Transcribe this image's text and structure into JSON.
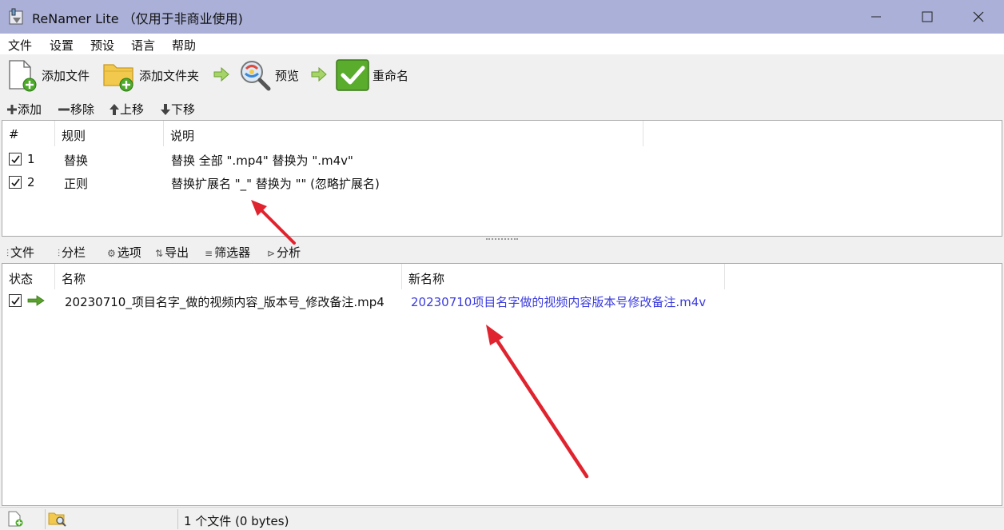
{
  "window": {
    "title": "ReNamer Lite （仅用于非商业使用)"
  },
  "menu": [
    "文件",
    "设置",
    "预设",
    "语言",
    "帮助"
  ],
  "toolbar": {
    "add_files": "添加文件",
    "add_folder": "添加文件夹",
    "preview": "预览",
    "rename": "重命名"
  },
  "rule_toolbar": {
    "add": "添加",
    "remove": "移除",
    "move_up": "上移",
    "move_down": "下移"
  },
  "rules_table": {
    "headers": [
      "#",
      "规则",
      "说明"
    ],
    "rows": [
      {
        "checked": true,
        "num": "1",
        "rule": "替换",
        "desc": "替换 全部 \".mp4\" 替换为 \".m4v\""
      },
      {
        "checked": true,
        "num": "2",
        "rule": "正则",
        "desc": "替换扩展名 \"_\" 替换为 \"\" (忽略扩展名)"
      }
    ]
  },
  "file_toolbar": [
    "文件",
    "分栏",
    "选项",
    "导出",
    "筛选器",
    "分析"
  ],
  "files_table": {
    "headers": [
      "状态",
      "名称",
      "新名称"
    ],
    "rows": [
      {
        "checked": true,
        "name": "20230710_项目名字_做的视频内容_版本号_修改备注.mp4",
        "new_name": "20230710项目名字做的视频内容版本号修改备注.m4v"
      }
    ]
  },
  "status_bar": {
    "text": "1 个文件 (0 bytes)"
  },
  "colors": {
    "titlebar": "#aab0d8",
    "new_name_text": "#3a3adf",
    "annotation_arrow": "#e0242f",
    "green_arrow": "#5aa02c"
  }
}
